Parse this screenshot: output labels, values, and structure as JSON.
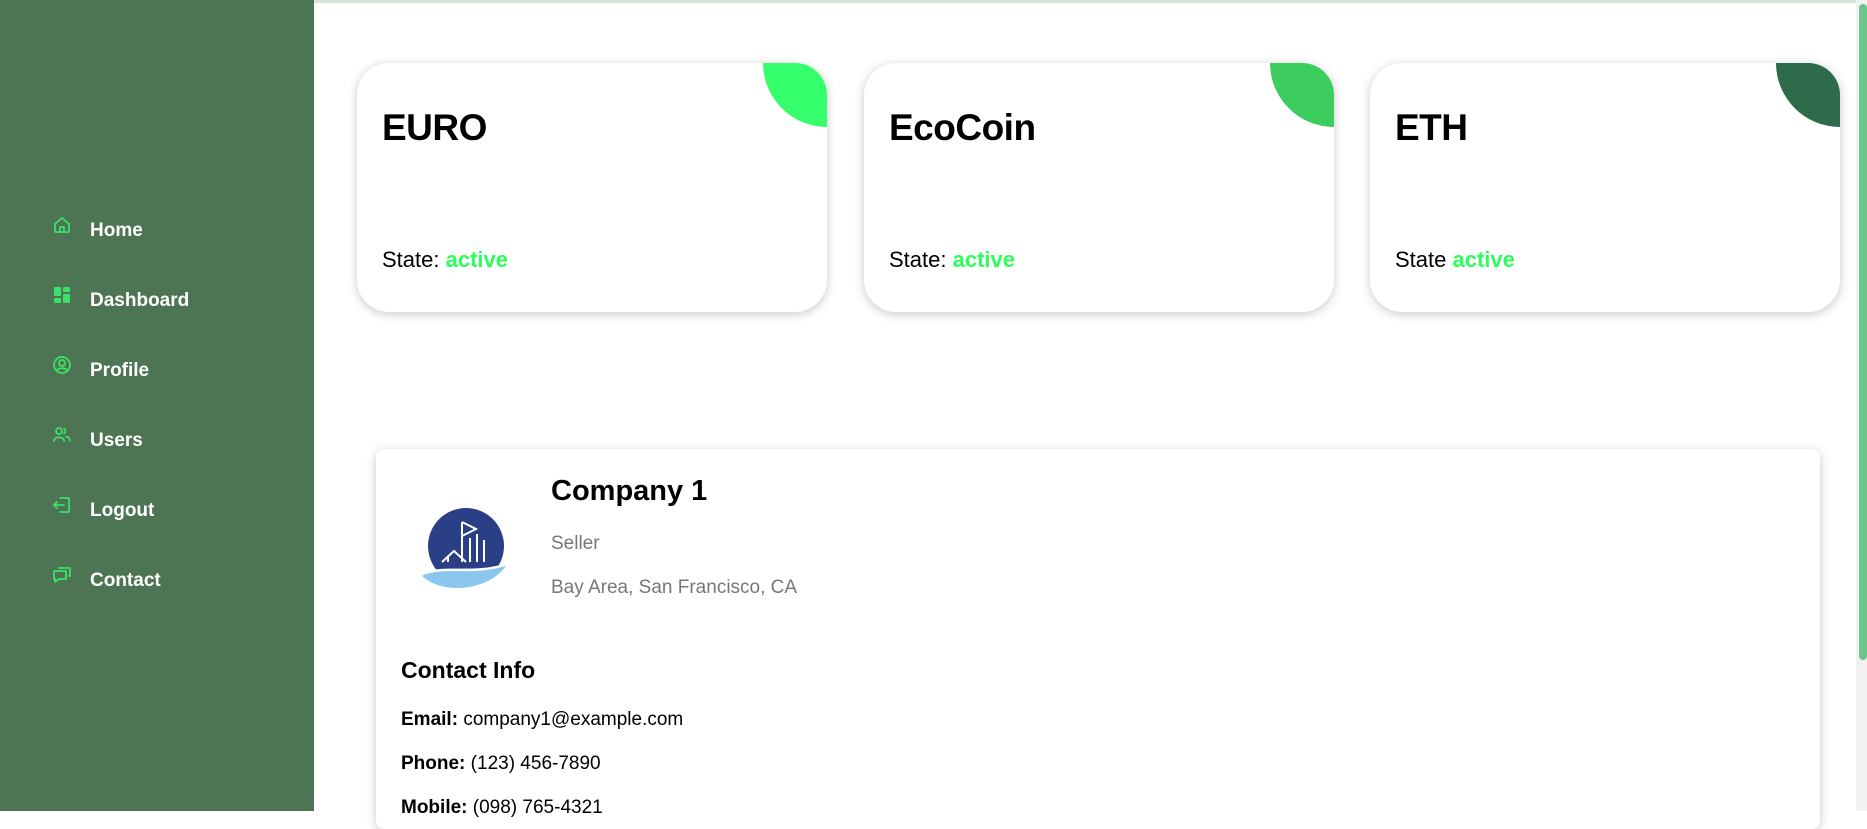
{
  "sidebar": {
    "items": [
      {
        "label": "Home",
        "icon": "home-icon"
      },
      {
        "label": "Dashboard",
        "icon": "dashboard-icon"
      },
      {
        "label": "Profile",
        "icon": "profile-icon"
      },
      {
        "label": "Users",
        "icon": "users-icon"
      },
      {
        "label": "Logout",
        "icon": "logout-icon"
      },
      {
        "label": "Contact",
        "icon": "contact-icon"
      }
    ]
  },
  "colors": {
    "sidebar_bg": "#4d7553",
    "icon_green": "#3ddf6a",
    "status_green": "#2bff5a",
    "euro_corner": "#35ff6c",
    "ecocoin_corner": "#3dcd5f",
    "eth_corner": "#2d6b4a"
  },
  "cards": [
    {
      "title": "EURO",
      "state_label": "State:",
      "status": "active"
    },
    {
      "title": "EcoCoin",
      "state_label": "State:",
      "status": "active"
    },
    {
      "title": "ETH",
      "state_label": "State",
      "status": "active"
    }
  ],
  "company": {
    "name": "Company 1",
    "role": "Seller",
    "location": "Bay Area, San Francisco, CA",
    "contact_heading": "Contact Info",
    "email_label": "Email:",
    "email": "company1@example.com",
    "phone_label": "Phone:",
    "phone": "(123) 456-7890",
    "mobile_label": "Mobile:",
    "mobile": "(098) 765-4321"
  }
}
